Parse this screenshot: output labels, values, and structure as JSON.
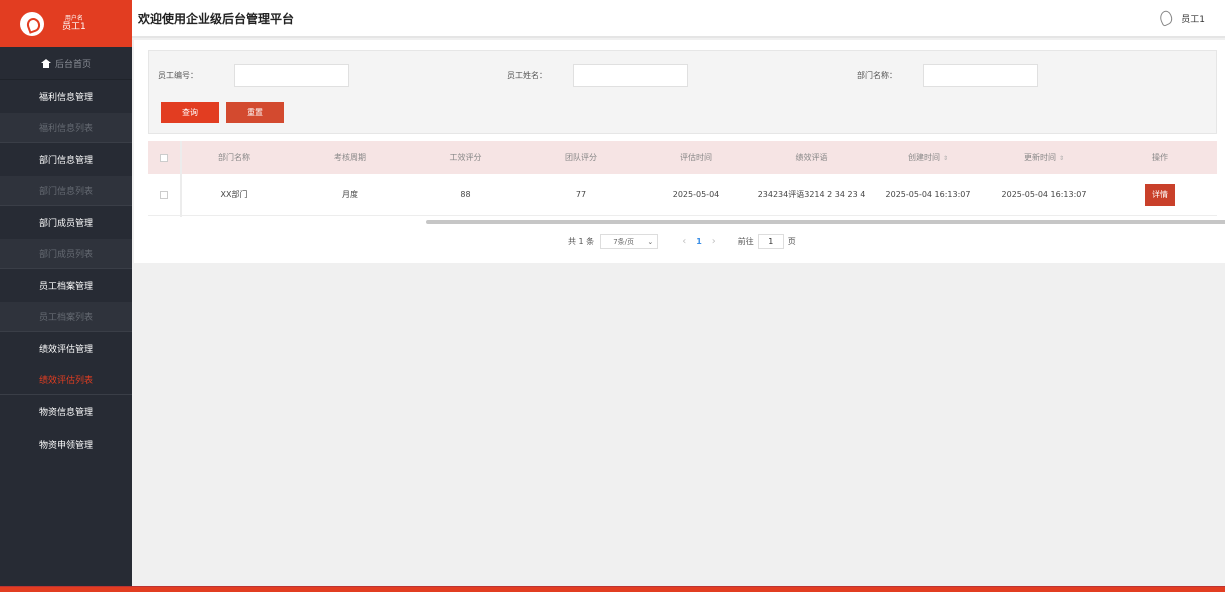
{
  "sidebar": {
    "user_label": "用户名",
    "user_value": "员工1",
    "home": "后台首页",
    "items": [
      {
        "label": "福利信息管理",
        "type": "group"
      },
      {
        "label": "福利信息列表",
        "type": "sub"
      },
      {
        "label": "部门信息管理",
        "type": "group"
      },
      {
        "label": "部门信息列表",
        "type": "sub"
      },
      {
        "label": "部门成员管理",
        "type": "group"
      },
      {
        "label": "部门成员列表",
        "type": "sub"
      },
      {
        "label": "员工档案管理",
        "type": "group"
      },
      {
        "label": "员工档案列表",
        "type": "sub"
      },
      {
        "label": "绩效评估管理",
        "type": "group"
      },
      {
        "label": "绩效评估列表",
        "type": "sub-active"
      },
      {
        "label": "物资信息管理",
        "type": "group"
      },
      {
        "label": "物资申领管理",
        "type": "group"
      }
    ]
  },
  "header": {
    "title": "欢迎使用企业级后台管理平台",
    "user": "员工1"
  },
  "search": {
    "fields": [
      {
        "label": "员工编号：",
        "value": ""
      },
      {
        "label": "员工姓名：",
        "value": ""
      },
      {
        "label": "部门名称：",
        "value": ""
      }
    ],
    "query_label": "查询",
    "reset_label": "重置"
  },
  "table": {
    "columns": [
      "部门名称",
      "考核周期",
      "工效评分",
      "团队评分",
      "评估时间",
      "绩效评语",
      "创建时间",
      "更新时间",
      "操作"
    ],
    "sort_glyph": "⇕",
    "rows": [
      {
        "dept": "XX部门",
        "cycle": "月度",
        "work_score": "88",
        "team_score": "77",
        "eval_time": "2025-05-04",
        "comment": "234234评语3214 2 34 23 4",
        "created": "2025-05-04 16:13:07",
        "updated": "2025-05-04 16:13:07",
        "action": "详情"
      }
    ]
  },
  "pagination": {
    "total": "共 1 条",
    "page_size": "7条/页",
    "current_page": "1",
    "goto_prefix": "前往",
    "goto_value": "1",
    "goto_suffix": "页"
  },
  "colors": {
    "accent": "#e23d21",
    "sidebar_bg": "#272b34",
    "header_row_bg": "#f6e4e4"
  }
}
